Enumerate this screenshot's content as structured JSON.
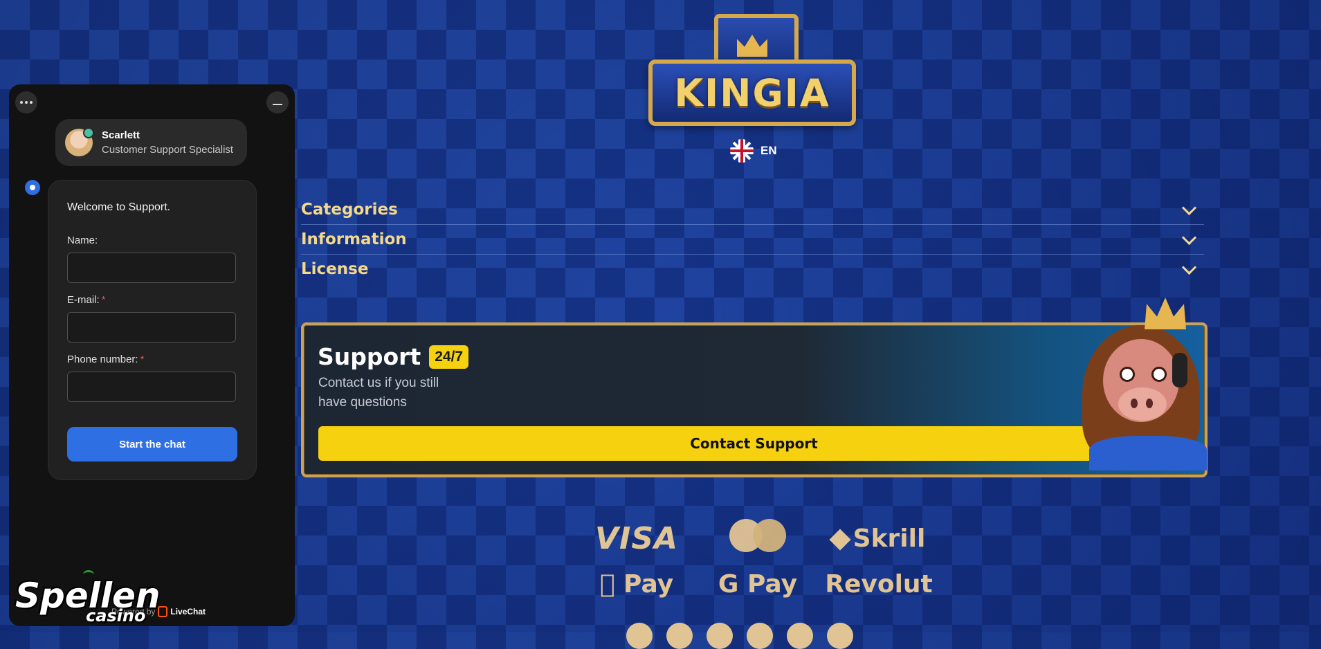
{
  "brand": {
    "logo_text": "KINGIA"
  },
  "language": {
    "code": "EN",
    "flag_icon": "uk-flag-icon"
  },
  "accordion": {
    "items": [
      {
        "label": "Categories"
      },
      {
        "label": "Information"
      },
      {
        "label": "License"
      }
    ]
  },
  "support": {
    "title": "Support",
    "badge": "24/7",
    "subtitle": "Contact us if you still have questions",
    "button_label": "Contact Support"
  },
  "payments": {
    "row1": [
      "VISA",
      "Mastercard",
      "Skrill"
    ],
    "row2": [
      "Pay",
      "G Pay",
      "Revolut"
    ]
  },
  "chat": {
    "agent_name": "Scarlett",
    "agent_role": "Customer Support Specialist",
    "welcome": "Welcome to Support.",
    "fields": [
      {
        "label": "Name:",
        "required": false,
        "value": ""
      },
      {
        "label": "E-mail:",
        "required": true,
        "value": ""
      },
      {
        "label": "Phone number:",
        "required": true,
        "value": ""
      }
    ],
    "start_button": "Start the chat",
    "powered_by": "Powered by",
    "powered_brand": "LiveChat"
  },
  "watermark": {
    "main": "Spellen",
    "sub": "casino"
  },
  "colors": {
    "accent_yellow": "#f6d110",
    "gold": "#f5d98a",
    "chat_blue": "#2f6fe4",
    "background_blue": "#1d3f9a"
  }
}
